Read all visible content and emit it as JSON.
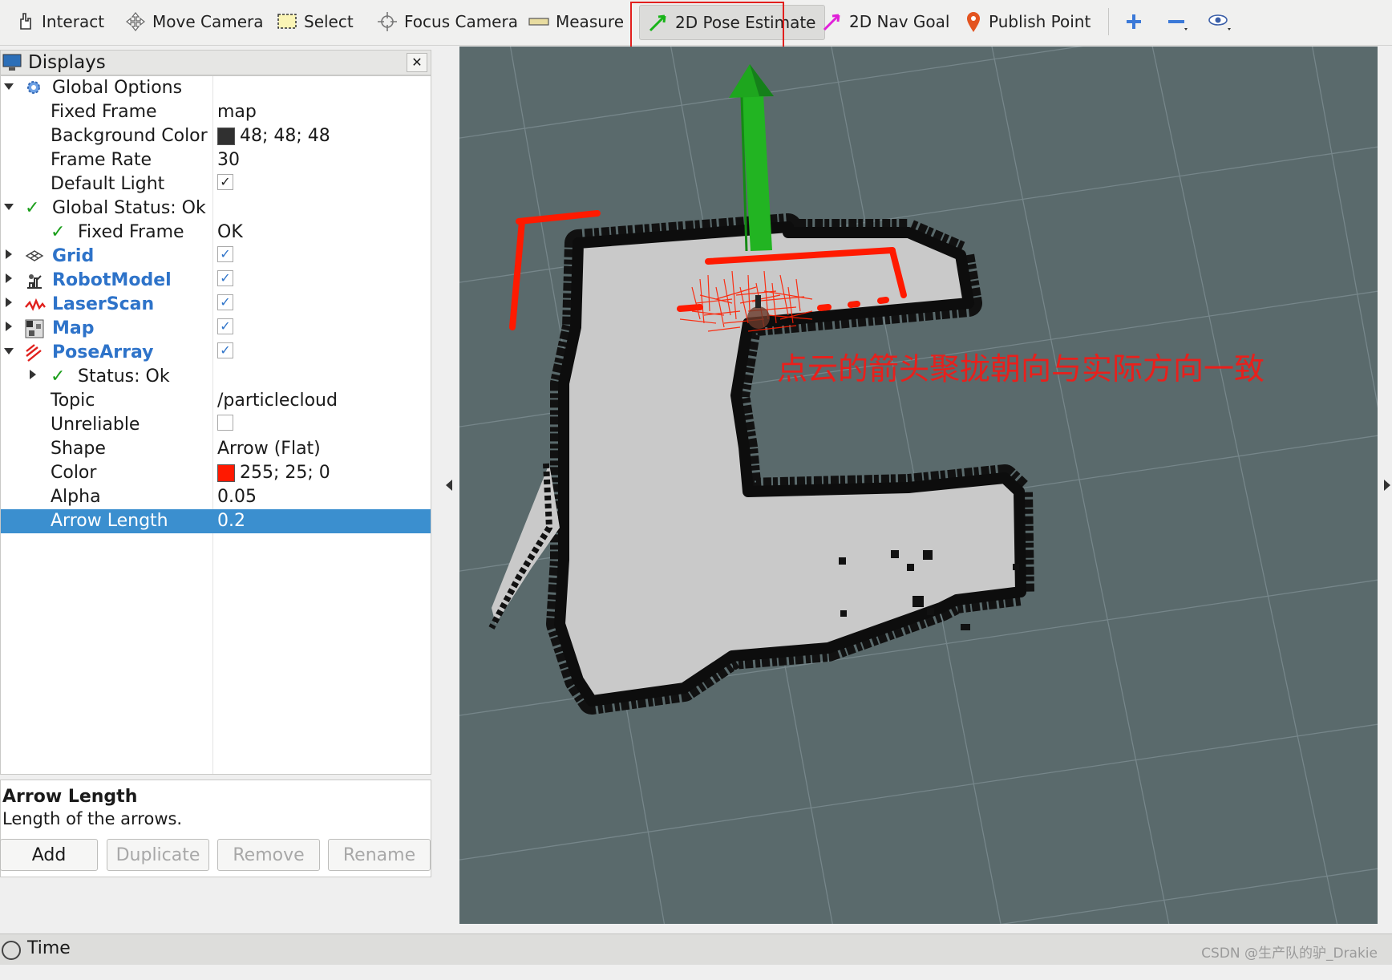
{
  "toolbar": {
    "tools": [
      {
        "label": "Interact",
        "icon": "hand-pointer-icon"
      },
      {
        "label": "Move Camera",
        "icon": "move-camera-icon"
      },
      {
        "label": "Select",
        "icon": "select-box-icon"
      },
      {
        "label": "Focus Camera",
        "icon": "focus-camera-icon"
      },
      {
        "label": "Measure",
        "icon": "ruler-icon"
      },
      {
        "label": "2D Pose Estimate",
        "icon": "green-arrow-icon"
      },
      {
        "label": "2D Nav Goal",
        "icon": "magenta-arrow-icon"
      },
      {
        "label": "Publish Point",
        "icon": "map-pin-icon"
      }
    ],
    "active_tool": "2D Pose Estimate",
    "zoom_icons": [
      "plus-icon",
      "minus-icon",
      "eye-icon"
    ]
  },
  "displays": {
    "title": "Displays",
    "rows": [
      {
        "name": "Global Options",
        "value": ""
      },
      {
        "name": "Fixed Frame",
        "value": "map"
      },
      {
        "name": "Background Color",
        "value": "48; 48; 48",
        "swatch": "#303030"
      },
      {
        "name": "Frame Rate",
        "value": "30"
      },
      {
        "name": "Default Light",
        "value": "✓"
      },
      {
        "name": "Global Status: Ok",
        "value": ""
      },
      {
        "name": "Fixed Frame",
        "value": "OK"
      },
      {
        "name": "Grid",
        "value": "✓"
      },
      {
        "name": "RobotModel",
        "value": "✓"
      },
      {
        "name": "LaserScan",
        "value": "✓"
      },
      {
        "name": "Map",
        "value": "✓"
      },
      {
        "name": "PoseArray",
        "value": "✓"
      },
      {
        "name": "Status: Ok",
        "value": ""
      },
      {
        "name": "Topic",
        "value": "/particlecloud"
      },
      {
        "name": "Unreliable",
        "value": ""
      },
      {
        "name": "Shape",
        "value": "Arrow (Flat)"
      },
      {
        "name": "Color",
        "value": "255; 25; 0",
        "swatch": "#ff1900"
      },
      {
        "name": "Alpha",
        "value": "0.05"
      },
      {
        "name": "Arrow Length",
        "value": "0.2"
      }
    ],
    "description": {
      "title": "Arrow Length",
      "text": "Length of the arrows."
    },
    "buttons": {
      "add": "Add",
      "duplicate": "Duplicate",
      "remove": "Remove",
      "rename": "Rename"
    }
  },
  "viewport": {
    "annotation": "点云的箭头聚拢朝向与实际方向一致",
    "background_color": "#5a6a6c",
    "pose_arrow_color": "#22b422",
    "particle_color": "#ff1900"
  },
  "statusbar": {
    "time_label": "Time",
    "watermark": "CSDN @生产队的驴_Drakie"
  }
}
